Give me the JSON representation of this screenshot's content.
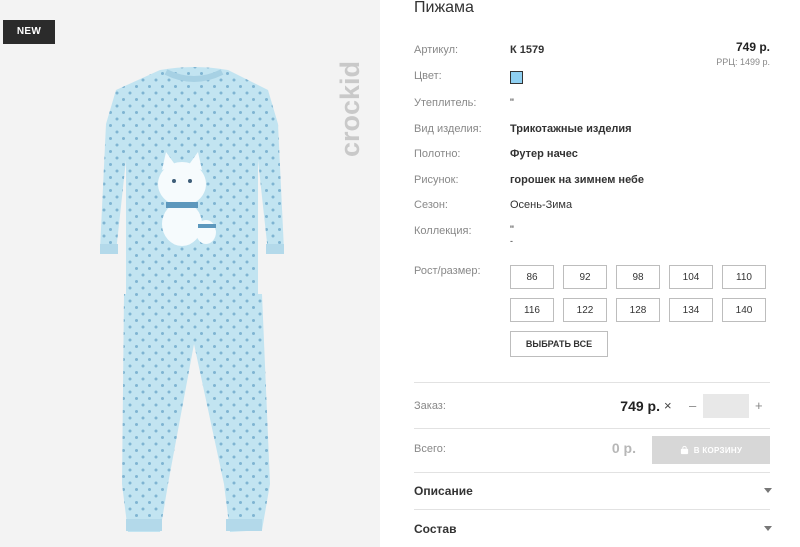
{
  "badge": {
    "text": "NEW"
  },
  "brand": {
    "logo_text": "crockid"
  },
  "product": {
    "title": "Пижама",
    "price": "749 р.",
    "rrp": "РРЦ: 1499 р.",
    "attributes": [
      {
        "label": "Артикул:",
        "value": "К 1579"
      },
      {
        "label": "Цвет:",
        "value": "",
        "swatch_color": "#8fd0f2"
      },
      {
        "label": "Утеплитель:",
        "value": "\""
      },
      {
        "label": "Вид изделия:",
        "value": "Трикотажные изделия"
      },
      {
        "label": "Полотно:",
        "value": "Футер начес"
      },
      {
        "label": "Рисунок:",
        "value": "горошек на зимнем небе"
      },
      {
        "label": "Сезон:",
        "value": "Осень-Зима"
      },
      {
        "label": "Коллекция:",
        "value": "\"",
        "extra": "-"
      }
    ]
  },
  "sizes": {
    "label": "Рост/размер:",
    "options": [
      "86",
      "92",
      "98",
      "104",
      "110",
      "116",
      "122",
      "128",
      "134",
      "140"
    ],
    "select_all": "ВЫБРАТЬ ВСЕ"
  },
  "order": {
    "label": "Заказ:",
    "price": "749 р.",
    "multiply": "×",
    "minus": "–",
    "plus": "+",
    "quantity": ""
  },
  "total": {
    "label": "Всего:",
    "value": "0 р.",
    "cart_button": "В КОРЗИНУ"
  },
  "accordion": [
    {
      "title": "Описание"
    },
    {
      "title": "Состав"
    }
  ],
  "colors": {
    "garment": "#bfe3f0",
    "dots": "#7fb4d2",
    "cart_button_disabled": "#d7d7d7"
  },
  "icons": [
    "crockid-logo-icon",
    "cart-icon",
    "chevron-down-icon"
  ]
}
